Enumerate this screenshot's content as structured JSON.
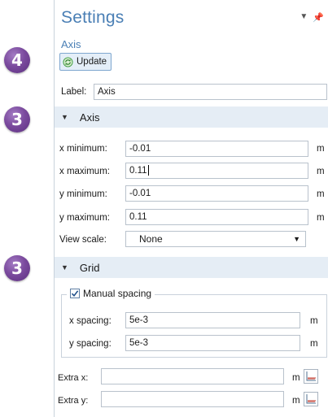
{
  "steps": [
    "4",
    "3",
    "3"
  ],
  "header": {
    "title": "Settings",
    "subtitle": "Axis",
    "update_label": "Update"
  },
  "label_field": {
    "label": "Label:",
    "value": "Axis"
  },
  "axis_section": {
    "title": "Axis",
    "fields": [
      {
        "label": "x minimum:",
        "value": "-0.01",
        "unit": "m"
      },
      {
        "label": "x maximum:",
        "value": "0.11",
        "unit": "m"
      },
      {
        "label": "y minimum:",
        "value": "-0.01",
        "unit": "m"
      },
      {
        "label": "y maximum:",
        "value": "0.11",
        "unit": "m"
      }
    ],
    "view_scale": {
      "label": "View scale:",
      "value": "None"
    }
  },
  "grid_section": {
    "title": "Grid",
    "manual_spacing_label": "Manual spacing",
    "manual_spacing_checked": true,
    "x_spacing": {
      "label": "x spacing:",
      "value": "5e-3",
      "unit": "m"
    },
    "y_spacing": {
      "label": "y spacing:",
      "value": "5e-3",
      "unit": "m"
    },
    "extra_x": {
      "label": "Extra x:",
      "value": "",
      "unit": "m"
    },
    "extra_y": {
      "label": "Extra y:",
      "value": "",
      "unit": "m"
    }
  },
  "colors": {
    "accent": "#4a7fb5",
    "section_bg": "#e5edf5",
    "badge": "#7b4b9e"
  }
}
